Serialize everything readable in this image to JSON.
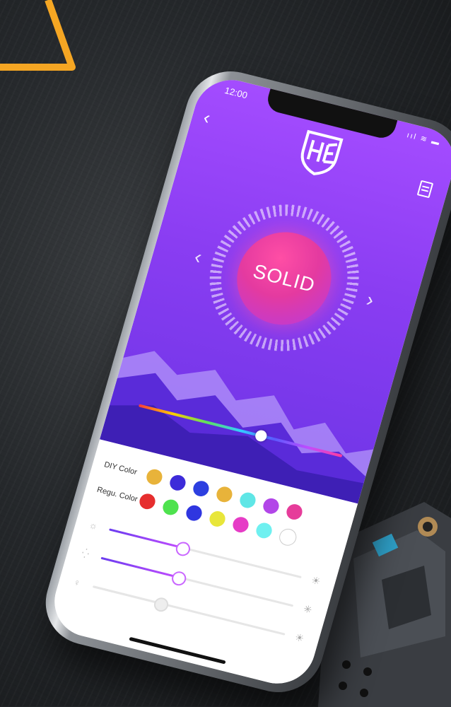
{
  "status_bar": {
    "time": "12:00",
    "icons": "ııl ≋ ▬"
  },
  "mode": {
    "label": "SOLID"
  },
  "colors": {
    "accent": "#8a3df2",
    "diy_label": "DIY Color",
    "regu_label": "Regu. Color",
    "diy": [
      "#e8b33a",
      "#3d2bd9",
      "#2d3fe0",
      "#e8b33a",
      "#5fe6e6",
      "#b246e8",
      "#e63c9a"
    ],
    "regu": [
      "#e62e2e",
      "#4ee24e",
      "#2f36e0",
      "#e8e63a",
      "#e63cc6",
      "#6ff0f0",
      "#ffffff"
    ]
  },
  "rainbow_slider": {
    "value": 0.6
  },
  "sliders": [
    {
      "name": "brightness",
      "icon": "☼",
      "end_icon": "☀",
      "value": 0.38,
      "active": true
    },
    {
      "name": "speed",
      "icon": "⁛",
      "end_icon": "✳",
      "value": 0.4,
      "active": true
    },
    {
      "name": "sensitivity",
      "icon": "♀",
      "end_icon": "☀",
      "value": 0.35,
      "active": false
    }
  ]
}
